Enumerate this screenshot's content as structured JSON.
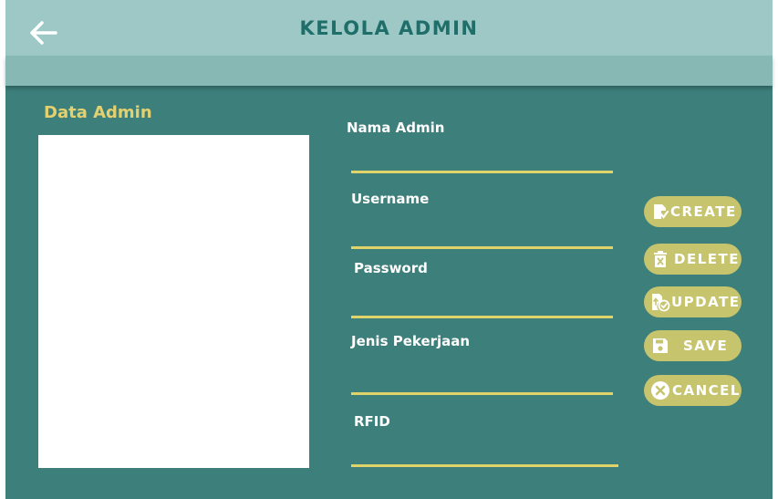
{
  "header": {
    "title": "KELOLA ADMIN",
    "back_icon": "arrow-left-icon"
  },
  "list": {
    "label": "Data Admin",
    "items": []
  },
  "form": {
    "nama_admin": {
      "label": "Nama Admin",
      "value": ""
    },
    "username": {
      "label": "Username",
      "value": ""
    },
    "password": {
      "label": "Password",
      "value": ""
    },
    "jenis_pekerjaan": {
      "label": "Jenis Pekerjaan",
      "value": ""
    },
    "rfid": {
      "label": "RFID",
      "value": ""
    }
  },
  "actions": {
    "create": {
      "label": "CREATE",
      "icon": "create-doc-icon"
    },
    "delete": {
      "label": "DELETE",
      "icon": "trash-icon"
    },
    "update": {
      "label": "UPDATE",
      "icon": "update-doc-icon"
    },
    "save": {
      "label": "SAVE",
      "icon": "floppy-disk-icon"
    },
    "cancel": {
      "label": "CANCEL",
      "icon": "cancel-circle-icon"
    }
  },
  "colors": {
    "background": "#3d7f7b",
    "header": "#9dc8c5",
    "accent_label": "#e3d170",
    "button": "#c7c46e",
    "title": "#1f6e6a"
  }
}
